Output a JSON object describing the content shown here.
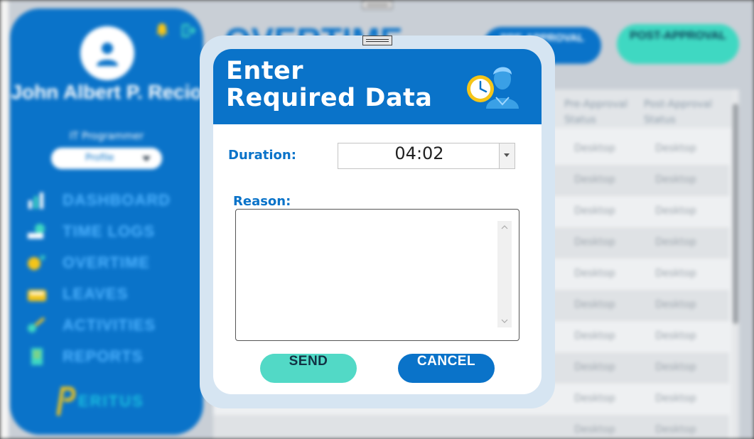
{
  "sidebar": {
    "user_name": "John Albert P. Recio",
    "user_role": "IT Programmer",
    "profile_select": "Profile",
    "nav": [
      {
        "label": "DASHBOARD",
        "icon": "bar-chart-icon"
      },
      {
        "label": "TIME LOGS",
        "icon": "time-logs-icon"
      },
      {
        "label": "OVERTIME",
        "icon": "overtime-icon"
      },
      {
        "label": "LEAVES",
        "icon": "leaves-icon"
      },
      {
        "label": "ACTIVITIES",
        "icon": "activities-icon"
      },
      {
        "label": "REPORTS",
        "icon": "reports-icon"
      }
    ],
    "brand": "ERITUS"
  },
  "main": {
    "title": "OVERTIME",
    "pre_approval_label": "PRE-APPROVAL",
    "post_approval_label": "POST-APPROVAL",
    "table": {
      "headers": [
        "Pre-Approval Status",
        "Post-Approval Status"
      ],
      "rows": [
        [
          "Desktop",
          "Desktop"
        ],
        [
          "Desktop",
          "Desktop"
        ],
        [
          "Desktop",
          "Desktop"
        ],
        [
          "Desktop",
          "Desktop"
        ],
        [
          "Desktop",
          "Desktop"
        ],
        [
          "Desktop",
          "Desktop"
        ],
        [
          "Desktop",
          "Desktop"
        ],
        [
          "Desktop",
          "Desktop"
        ],
        [
          "Desktop",
          "Desktop"
        ],
        [
          "Desktop",
          "Desktop"
        ]
      ]
    }
  },
  "modal": {
    "title_line1": "Enter",
    "title_line2": "Required Data",
    "duration_label": "Duration:",
    "duration_value": "04:02",
    "reason_label": "Reason:",
    "reason_value": "",
    "send_label": "SEND",
    "cancel_label": "CANCEL"
  },
  "colors": {
    "primary": "#0a73c9",
    "accent": "#52d9c6",
    "modal_frame": "#d6e5f2"
  }
}
